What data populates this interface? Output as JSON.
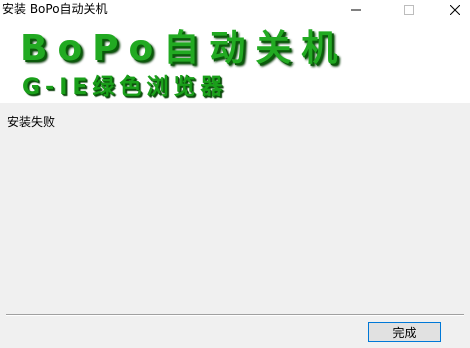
{
  "window": {
    "title": "安装 BoPo自动关机"
  },
  "banner": {
    "line1": "BoPo自动关机",
    "line2": "G-IE绿色浏览器"
  },
  "main": {
    "status_text": "安装失败"
  },
  "footer": {
    "finish_label": "完成"
  },
  "icons": {
    "minimize": "minimize-icon",
    "maximize": "maximize-icon",
    "close": "close-icon"
  },
  "colors": {
    "brand_green": "#22aa22",
    "button_border": "#0078d7"
  }
}
